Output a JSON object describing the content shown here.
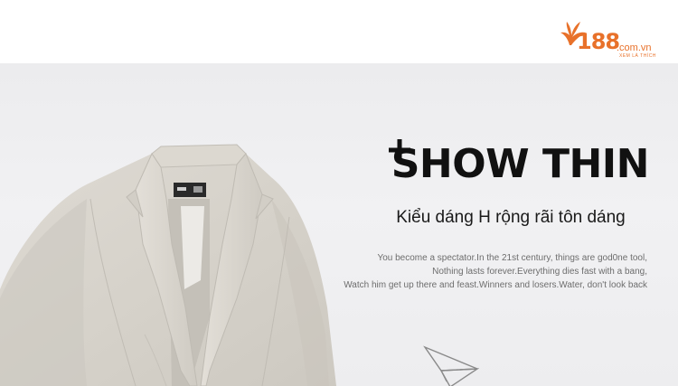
{
  "logo": {
    "number": "188",
    "domain": ".com.vn",
    "tagline": "XEM LÀ THÍCH",
    "brand_color": "#e8712a",
    "icon": "maple-leaf-icon"
  },
  "banner": {
    "background_color": "#efeff1",
    "headline": "SHOW THIN",
    "headline_prefix_icon": "plus-icon",
    "subtitle": "Kiểu dáng H rộng rãi tôn dáng",
    "description_lines": [
      "You become a spectator.In the 21st century, things are god0ne tool,",
      "Nothing lasts forever.Everything dies fast with a bang,",
      "Watch him get up there and feast.Winners and losers.Water, don't look back"
    ],
    "decoration_icon": "paper-plane-icon",
    "product": {
      "type": "blazer",
      "color": "#d8d4cc",
      "label_text": ""
    }
  }
}
